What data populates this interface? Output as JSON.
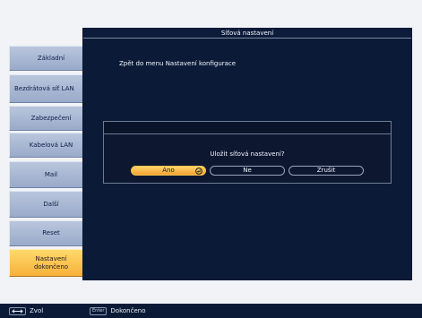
{
  "sidebar": {
    "items": [
      {
        "label": "Základní"
      },
      {
        "label": "Bezdrátová síť LAN"
      },
      {
        "label": "Zabezpečení"
      },
      {
        "label": "Kabelová LAN"
      },
      {
        "label": "Mail"
      },
      {
        "label": "Další"
      },
      {
        "label": "Reset"
      },
      {
        "label": "Nastavení dokončeno",
        "active": true
      }
    ]
  },
  "panel": {
    "title": "Síťová nastavení",
    "back_link": "Zpět do menu Nastavení konfigurace"
  },
  "dialog": {
    "question": "Uložit síťová nastavení?",
    "buttons": {
      "yes": "Ano",
      "no": "Ne",
      "cancel": "Zrušit"
    }
  },
  "statusbar": {
    "select_label": "Zvol",
    "enter_key": "Enter",
    "enter_label": "Dokončeno"
  },
  "colors": {
    "panel_bg": "#0b1b37",
    "accent": "#f8b13b",
    "sidebar_item": "#a9b8d3"
  },
  "icons": {
    "select": "left-right-arrow-icon",
    "enter": "enter-icon"
  }
}
